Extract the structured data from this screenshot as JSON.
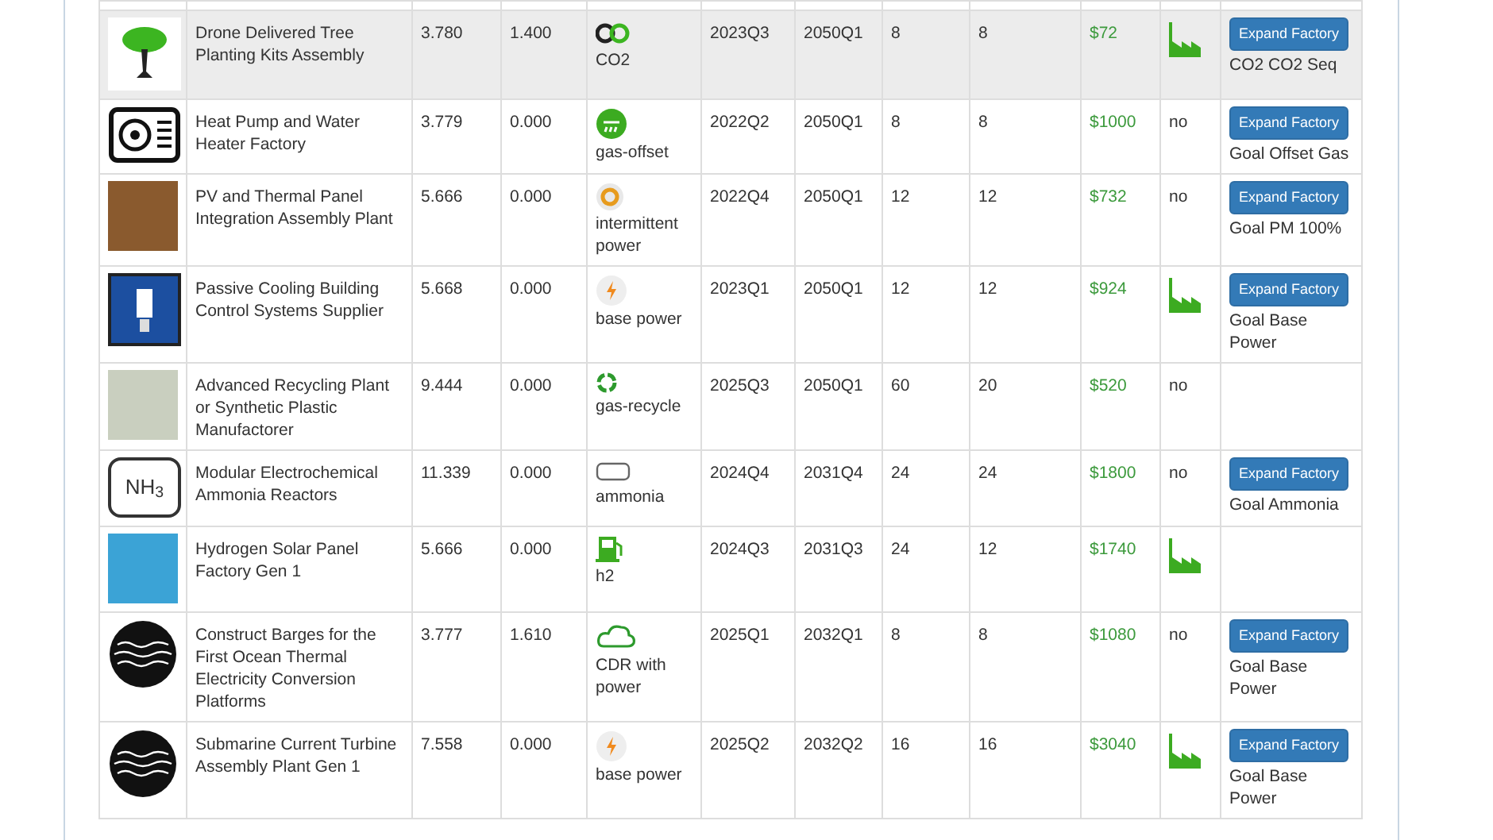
{
  "rows": [
    {
      "highlighted": true,
      "name": "Drone Delivered Tree Planting Kits Assembly",
      "value_1": "3.780",
      "value_2": "1.400",
      "resource": {
        "label": "CO2"
      },
      "start": "2023Q3",
      "end": "2050Q1",
      "count_1": "8",
      "count_2": "8",
      "price": "$72",
      "factory": {
        "kind": "icon"
      },
      "action": {
        "button": "Expand Factory",
        "goal": "CO2 CO2 Seq"
      }
    },
    {
      "highlighted": false,
      "name": "Heat Pump and Water Heater Factory",
      "value_1": "3.779",
      "value_2": "0.000",
      "resource": {
        "label": "gas-offset"
      },
      "start": "2022Q2",
      "end": "2050Q1",
      "count_1": "8",
      "count_2": "8",
      "price": "$1000",
      "factory": {
        "kind": "text",
        "text": "no"
      },
      "action": {
        "button": "Expand Factory",
        "goal": "Goal Offset Gas"
      }
    },
    {
      "highlighted": false,
      "name": "PV and Thermal Panel Integration Assembly Plant",
      "value_1": "5.666",
      "value_2": "0.000",
      "resource": {
        "label": "intermittent power"
      },
      "start": "2022Q4",
      "end": "2050Q1",
      "count_1": "12",
      "count_2": "12",
      "price": "$732",
      "factory": {
        "kind": "text",
        "text": "no"
      },
      "action": {
        "button": "Expand Factory",
        "goal": "Goal PM 100%"
      }
    },
    {
      "highlighted": false,
      "name": "Passive Cooling Building Control Systems Supplier",
      "value_1": "5.668",
      "value_2": "0.000",
      "resource": {
        "label": "base power"
      },
      "start": "2023Q1",
      "end": "2050Q1",
      "count_1": "12",
      "count_2": "12",
      "price": "$924",
      "factory": {
        "kind": "icon"
      },
      "action": {
        "button": "Expand Factory",
        "goal": "Goal Base Power"
      }
    },
    {
      "highlighted": false,
      "name": "Advanced Recycling Plant or Synthetic Plastic Manufactorer",
      "value_1": "9.444",
      "value_2": "0.000",
      "resource": {
        "label": "gas-recycle"
      },
      "start": "2025Q3",
      "end": "2050Q1",
      "count_1": "60",
      "count_2": "20",
      "price": "$520",
      "factory": {
        "kind": "text",
        "text": "no"
      }
    },
    {
      "highlighted": false,
      "image_text": "NH$_{3}$",
      "name": "Modular Electrochemical Ammonia Reactors",
      "value_1": "11.339",
      "value_2": "0.000",
      "resource": {
        "label": "ammonia"
      },
      "start": "2024Q4",
      "end": "2031Q4",
      "count_1": "24",
      "count_2": "24",
      "price": "$1800",
      "factory": {
        "kind": "text",
        "text": "no"
      },
      "action": {
        "button": "Expand Factory",
        "goal": "Goal Ammonia"
      }
    },
    {
      "highlighted": false,
      "name": "Hydrogen Solar Panel Factory Gen 1",
      "value_1": "5.666",
      "value_2": "0.000",
      "resource": {
        "label": "h2"
      },
      "start": "2024Q3",
      "end": "2031Q3",
      "count_1": "24",
      "count_2": "12",
      "price": "$1740",
      "factory": {
        "kind": "icon"
      }
    },
    {
      "highlighted": false,
      "name": "Construct Barges for the First Ocean Thermal Electricity Conversion Platforms",
      "value_1": "3.777",
      "value_2": "1.610",
      "resource": {
        "label": "CDR with power"
      },
      "start": "2025Q1",
      "end": "2032Q1",
      "count_1": "8",
      "count_2": "8",
      "price": "$1080",
      "factory": {
        "kind": "text",
        "text": "no"
      },
      "action": {
        "button": "Expand Factory",
        "goal": "Goal Base Power"
      }
    },
    {
      "highlighted": false,
      "name": "Submarine Current Turbine Assembly Plant Gen 1",
      "value_1": "7.558",
      "value_2": "0.000",
      "resource": {
        "label": "base power"
      },
      "start": "2025Q2",
      "end": "2032Q2",
      "count_1": "16",
      "count_2": "16",
      "price": "$3040",
      "factory": {
        "kind": "icon"
      },
      "action": {
        "button": "Expand Factory",
        "goal": "Goal Base Power"
      }
    }
  ]
}
